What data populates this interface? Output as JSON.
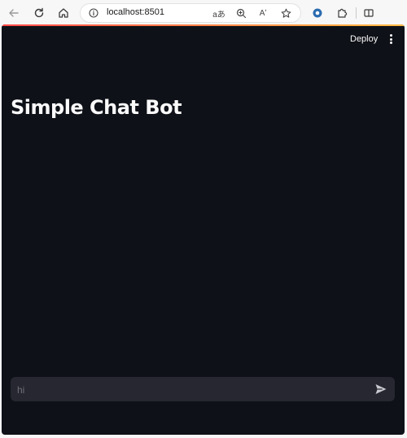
{
  "browser": {
    "url": "localhost:8501",
    "read_aloud_label": "Aʹ",
    "translate_label": "aあ",
    "icons": [
      "back-icon",
      "refresh-icon",
      "home-icon",
      "info-icon",
      "translate-icon",
      "zoom-icon",
      "read-aloud-icon",
      "favorite-star-icon",
      "extension-badge-icon",
      "extensions-icon",
      "split-screen-icon"
    ]
  },
  "app": {
    "accent_colors": [
      "#ff4b4b",
      "#ffbd45"
    ],
    "background": "#0e1117",
    "header": {
      "deploy_label": "Deploy"
    },
    "title": "Simple Chat Bot",
    "chat_input": {
      "placeholder": "hi",
      "value": ""
    }
  }
}
